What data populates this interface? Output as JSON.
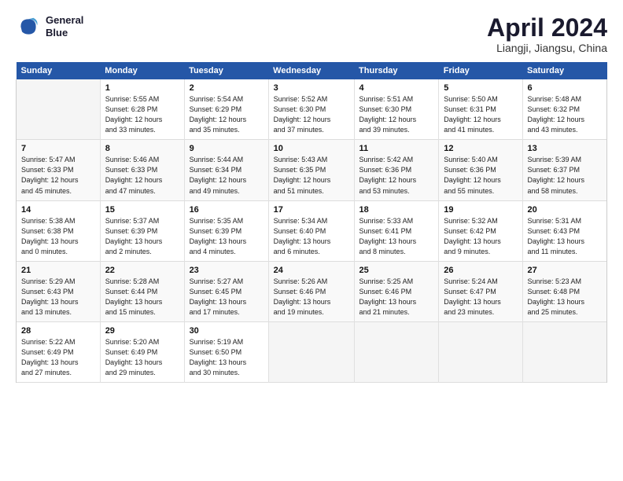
{
  "header": {
    "logo_line1": "General",
    "logo_line2": "Blue",
    "month": "April 2024",
    "location": "Liangji, Jiangsu, China"
  },
  "weekdays": [
    "Sunday",
    "Monday",
    "Tuesday",
    "Wednesday",
    "Thursday",
    "Friday",
    "Saturday"
  ],
  "weeks": [
    [
      {
        "day": "",
        "info": ""
      },
      {
        "day": "1",
        "info": "Sunrise: 5:55 AM\nSunset: 6:28 PM\nDaylight: 12 hours\nand 33 minutes."
      },
      {
        "day": "2",
        "info": "Sunrise: 5:54 AM\nSunset: 6:29 PM\nDaylight: 12 hours\nand 35 minutes."
      },
      {
        "day": "3",
        "info": "Sunrise: 5:52 AM\nSunset: 6:30 PM\nDaylight: 12 hours\nand 37 minutes."
      },
      {
        "day": "4",
        "info": "Sunrise: 5:51 AM\nSunset: 6:30 PM\nDaylight: 12 hours\nand 39 minutes."
      },
      {
        "day": "5",
        "info": "Sunrise: 5:50 AM\nSunset: 6:31 PM\nDaylight: 12 hours\nand 41 minutes."
      },
      {
        "day": "6",
        "info": "Sunrise: 5:48 AM\nSunset: 6:32 PM\nDaylight: 12 hours\nand 43 minutes."
      }
    ],
    [
      {
        "day": "7",
        "info": "Sunrise: 5:47 AM\nSunset: 6:33 PM\nDaylight: 12 hours\nand 45 minutes."
      },
      {
        "day": "8",
        "info": "Sunrise: 5:46 AM\nSunset: 6:33 PM\nDaylight: 12 hours\nand 47 minutes."
      },
      {
        "day": "9",
        "info": "Sunrise: 5:44 AM\nSunset: 6:34 PM\nDaylight: 12 hours\nand 49 minutes."
      },
      {
        "day": "10",
        "info": "Sunrise: 5:43 AM\nSunset: 6:35 PM\nDaylight: 12 hours\nand 51 minutes."
      },
      {
        "day": "11",
        "info": "Sunrise: 5:42 AM\nSunset: 6:36 PM\nDaylight: 12 hours\nand 53 minutes."
      },
      {
        "day": "12",
        "info": "Sunrise: 5:40 AM\nSunset: 6:36 PM\nDaylight: 12 hours\nand 55 minutes."
      },
      {
        "day": "13",
        "info": "Sunrise: 5:39 AM\nSunset: 6:37 PM\nDaylight: 12 hours\nand 58 minutes."
      }
    ],
    [
      {
        "day": "14",
        "info": "Sunrise: 5:38 AM\nSunset: 6:38 PM\nDaylight: 13 hours\nand 0 minutes."
      },
      {
        "day": "15",
        "info": "Sunrise: 5:37 AM\nSunset: 6:39 PM\nDaylight: 13 hours\nand 2 minutes."
      },
      {
        "day": "16",
        "info": "Sunrise: 5:35 AM\nSunset: 6:39 PM\nDaylight: 13 hours\nand 4 minutes."
      },
      {
        "day": "17",
        "info": "Sunrise: 5:34 AM\nSunset: 6:40 PM\nDaylight: 13 hours\nand 6 minutes."
      },
      {
        "day": "18",
        "info": "Sunrise: 5:33 AM\nSunset: 6:41 PM\nDaylight: 13 hours\nand 8 minutes."
      },
      {
        "day": "19",
        "info": "Sunrise: 5:32 AM\nSunset: 6:42 PM\nDaylight: 13 hours\nand 9 minutes."
      },
      {
        "day": "20",
        "info": "Sunrise: 5:31 AM\nSunset: 6:43 PM\nDaylight: 13 hours\nand 11 minutes."
      }
    ],
    [
      {
        "day": "21",
        "info": "Sunrise: 5:29 AM\nSunset: 6:43 PM\nDaylight: 13 hours\nand 13 minutes."
      },
      {
        "day": "22",
        "info": "Sunrise: 5:28 AM\nSunset: 6:44 PM\nDaylight: 13 hours\nand 15 minutes."
      },
      {
        "day": "23",
        "info": "Sunrise: 5:27 AM\nSunset: 6:45 PM\nDaylight: 13 hours\nand 17 minutes."
      },
      {
        "day": "24",
        "info": "Sunrise: 5:26 AM\nSunset: 6:46 PM\nDaylight: 13 hours\nand 19 minutes."
      },
      {
        "day": "25",
        "info": "Sunrise: 5:25 AM\nSunset: 6:46 PM\nDaylight: 13 hours\nand 21 minutes."
      },
      {
        "day": "26",
        "info": "Sunrise: 5:24 AM\nSunset: 6:47 PM\nDaylight: 13 hours\nand 23 minutes."
      },
      {
        "day": "27",
        "info": "Sunrise: 5:23 AM\nSunset: 6:48 PM\nDaylight: 13 hours\nand 25 minutes."
      }
    ],
    [
      {
        "day": "28",
        "info": "Sunrise: 5:22 AM\nSunset: 6:49 PM\nDaylight: 13 hours\nand 27 minutes."
      },
      {
        "day": "29",
        "info": "Sunrise: 5:20 AM\nSunset: 6:49 PM\nDaylight: 13 hours\nand 29 minutes."
      },
      {
        "day": "30",
        "info": "Sunrise: 5:19 AM\nSunset: 6:50 PM\nDaylight: 13 hours\nand 30 minutes."
      },
      {
        "day": "",
        "info": ""
      },
      {
        "day": "",
        "info": ""
      },
      {
        "day": "",
        "info": ""
      },
      {
        "day": "",
        "info": ""
      }
    ]
  ]
}
